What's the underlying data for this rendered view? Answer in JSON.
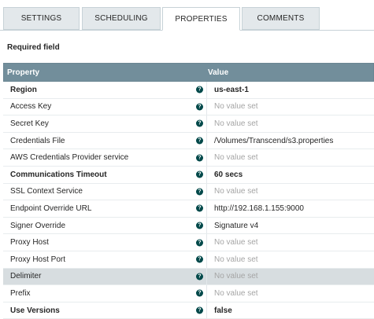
{
  "tabs": [
    {
      "label": "SETTINGS"
    },
    {
      "label": "SCHEDULING"
    },
    {
      "label": "PROPERTIES",
      "active": true
    },
    {
      "label": "COMMENTS"
    }
  ],
  "required_field_label": "Required field",
  "table": {
    "headers": {
      "property": "Property",
      "value": "Value"
    },
    "rows": [
      {
        "property": "Region",
        "value": "us-east-1",
        "required": true,
        "empty": false
      },
      {
        "property": "Access Key",
        "value": "No value set",
        "required": false,
        "empty": true
      },
      {
        "property": "Secret Key",
        "value": "No value set",
        "required": false,
        "empty": true
      },
      {
        "property": "Credentials File",
        "value": "/Volumes/Transcend/s3.properties",
        "required": false,
        "empty": false
      },
      {
        "property": "AWS Credentials Provider service",
        "value": "No value set",
        "required": false,
        "empty": true
      },
      {
        "property": "Communications Timeout",
        "value": "60 secs",
        "required": true,
        "empty": false
      },
      {
        "property": "SSL Context Service",
        "value": "No value set",
        "required": false,
        "empty": true
      },
      {
        "property": "Endpoint Override URL",
        "value": "http://192.168.1.155:9000",
        "required": false,
        "empty": false
      },
      {
        "property": "Signer Override",
        "value": "Signature v4",
        "required": false,
        "empty": false
      },
      {
        "property": "Proxy Host",
        "value": "No value set",
        "required": false,
        "empty": true
      },
      {
        "property": "Proxy Host Port",
        "value": "No value set",
        "required": false,
        "empty": true
      },
      {
        "property": "Delimiter",
        "value": "No value set",
        "required": false,
        "empty": true,
        "selected": true
      },
      {
        "property": "Prefix",
        "value": "No value set",
        "required": false,
        "empty": true
      },
      {
        "property": "Use Versions",
        "value": "false",
        "required": true,
        "empty": false
      }
    ]
  },
  "icons": {
    "help": "help-icon",
    "help_glyph": "?"
  },
  "colors": {
    "header_bg": "#728e9b",
    "help_icon": "#004849",
    "placeholder": "#a5a5a5",
    "selected_row": "#d7dde0"
  }
}
